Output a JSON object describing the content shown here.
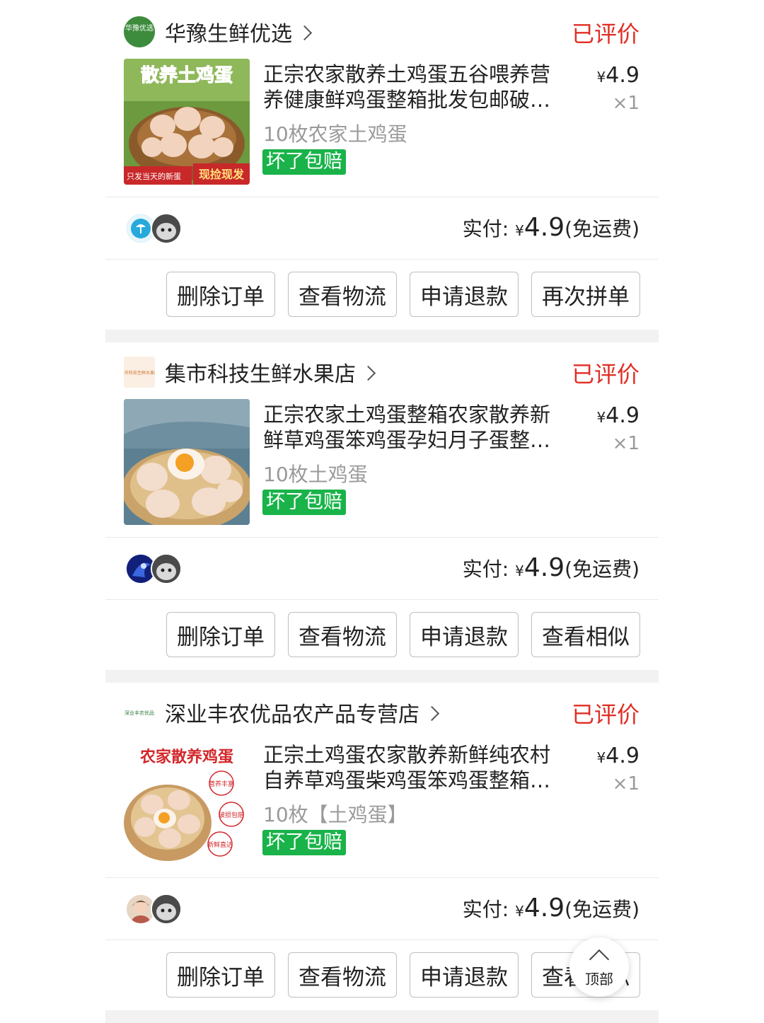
{
  "orders": [
    {
      "shop": {
        "name": "华豫生鲜优选",
        "logo_text": "华豫优选"
      },
      "status": "已评价",
      "product": {
        "title": "正宗农家散养土鸡蛋五谷喂养营养健康鲜鸡蛋整箱批发包邮破…",
        "spec": "10枚农家土鸡蛋",
        "tag": "坏了包赔",
        "image_text": {
          "top": "散养土鸡蛋",
          "bottom_left": "只发当天的新蛋",
          "bottom_right": "现捡现发"
        }
      },
      "price": {
        "currency": "¥",
        "value": "4.9"
      },
      "quantity": "×1",
      "paid": {
        "label": "实付:",
        "currency": "¥",
        "amount": "4.9",
        "note": "(免运费)"
      },
      "buttons": [
        "删除订单",
        "查看物流",
        "申请退款",
        "再次拼单"
      ]
    },
    {
      "shop": {
        "name": "集市科技生鲜水果店",
        "logo_text": "集市科技生鲜水果店"
      },
      "status": "已评价",
      "product": {
        "title": "正宗农家土鸡蛋整箱农家散养新鲜草鸡蛋笨鸡蛋孕妇月子蛋整…",
        "spec": "10枚土鸡蛋",
        "tag": "坏了包赔"
      },
      "price": {
        "currency": "¥",
        "value": "4.9"
      },
      "quantity": "×1",
      "paid": {
        "label": "实付:",
        "currency": "¥",
        "amount": "4.9",
        "note": "(免运费)"
      },
      "buttons": [
        "删除订单",
        "查看物流",
        "申请退款",
        "查看相似"
      ]
    },
    {
      "shop": {
        "name": "深业丰农优品农产品专营店",
        "logo_text": "深业丰农优品"
      },
      "status": "已评价",
      "product": {
        "title": "正宗土鸡蛋农家散养新鲜纯农村自养草鸡蛋柴鸡蛋笨鸡蛋整箱…",
        "spec": "10枚【土鸡蛋】",
        "tag": "坏了包赔",
        "image_text": {
          "top": "农家散养鸡蛋",
          "badge1": "营养丰富",
          "badge2": "破损包赔",
          "badge3": "新鲜直达"
        }
      },
      "price": {
        "currency": "¥",
        "value": "4.9"
      },
      "quantity": "×1",
      "paid": {
        "label": "实付:",
        "currency": "¥",
        "amount": "4.9",
        "note": "(免运费)"
      },
      "buttons": [
        "删除订单",
        "查看物流",
        "申请退款",
        "查看相似"
      ]
    }
  ],
  "back_to_top": {
    "label": "顶部",
    "icon": "chevron-up-icon"
  },
  "colors": {
    "status": "#e02e24",
    "tag": "#19b34a",
    "gap": "#f2f2f2"
  }
}
